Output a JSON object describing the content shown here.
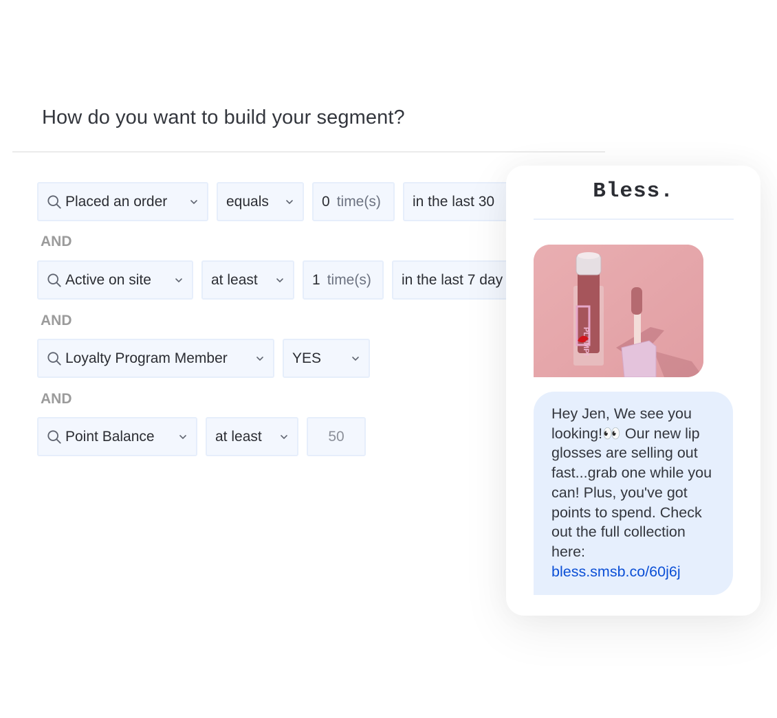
{
  "builder": {
    "question": "How do you want to build your segment?",
    "rows": [
      {
        "event": "Placed an order",
        "operator": "equals",
        "count_value": "0",
        "count_unit": "time(s)",
        "timeframe": "in the last 30"
      },
      {
        "event": "Active on site",
        "operator": "at least",
        "count_value": "1",
        "count_unit": "time(s)",
        "timeframe": "in the last 7 day"
      },
      {
        "event": "Loyalty Program Member",
        "operator": "YES"
      },
      {
        "event": "Point Balance",
        "operator": "at least",
        "value_placeholder": "50"
      }
    ],
    "connector": "AND"
  },
  "message_preview": {
    "brand": "Bless.",
    "image_alt": "Pink lip gloss bottle with open applicator on pink background",
    "message_text": "Hey Jen, We see you looking!👀 Our new lip glosses are selling out fast...grab one while you can! Plus, you've got points to spend. Check out the full collection here:",
    "link": "bless.smsb.co/60j6j"
  },
  "colors": {
    "field_bg": "#f3f7fe",
    "field_border": "#e6eefb",
    "bubble_bg": "#e6effd",
    "link": "#0b4fd6",
    "and_label": "#9b9b9b"
  },
  "icons": {
    "search": "search-icon",
    "dropdown": "chevron-down-icon"
  }
}
